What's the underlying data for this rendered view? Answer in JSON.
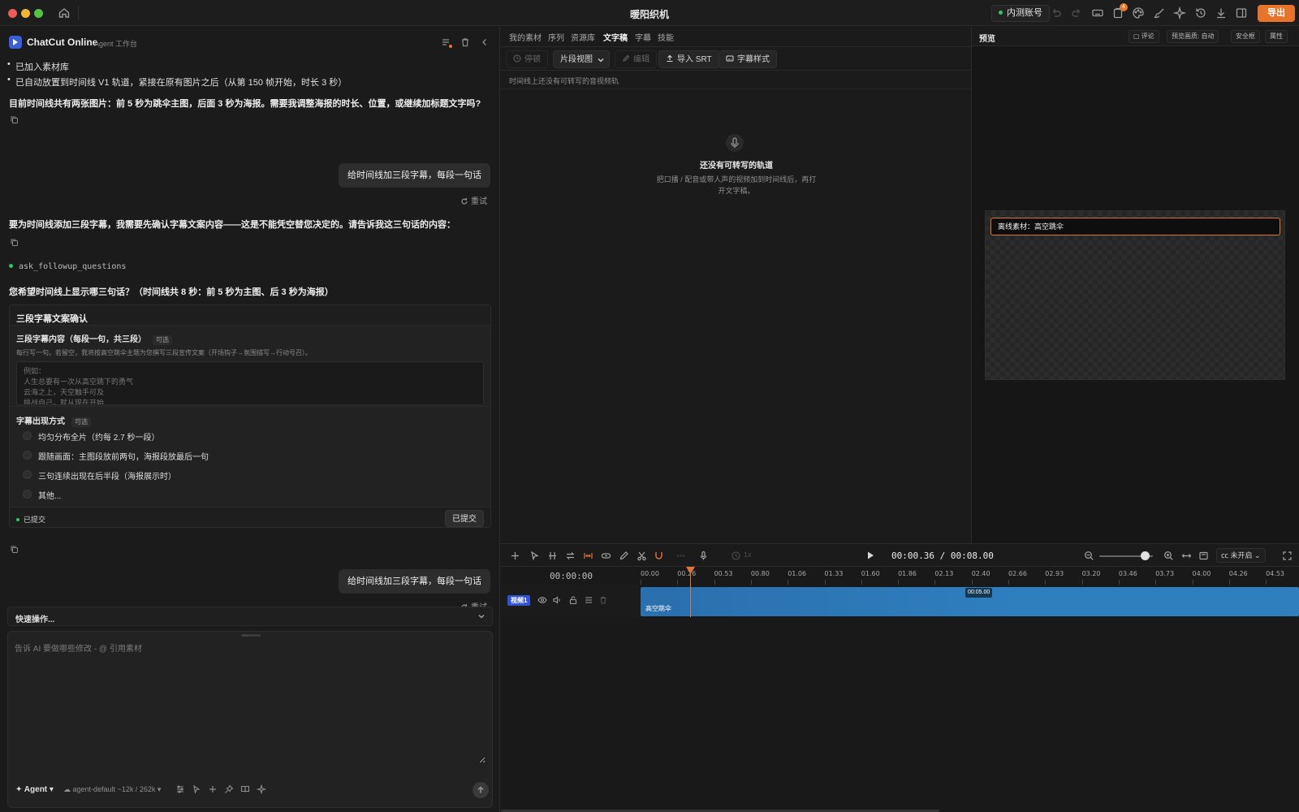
{
  "window": {
    "title": "暖阳织机",
    "beta_account": "内测账号",
    "export_label": "导出",
    "notification_count": "4",
    "colors": {
      "accent": "#e8742c",
      "clip": "#2f7fbf",
      "track_tag": "#3353d6"
    }
  },
  "agent_panel": {
    "app_name": "ChatCut Online",
    "subtitle": "Agent 工作台",
    "messages": {
      "bullet1": "已加入素材库",
      "bullet2": "已自动放置到时间线 V1 轨道，紧接在原有图片之后（从第 150 帧开始，时长 3 秒）",
      "assistant1": "目前时间线共有两张图片：前 5 秒为跳伞主图，后面 3 秒为海报。需要我调整海报的时长、位置，或继续加标题文字吗?",
      "user1": "给时间线加三段字幕，每段一句话",
      "retry1": "重试",
      "assistant2": "要为时间线添加三段字幕，我需要先确认字幕文案内容——这是不能凭空替您决定的。请告诉我这三句话的内容：",
      "tool_call": "ask_followup_questions",
      "assistant3": "您希望时间线上显示哪三句话？（时间线共 8 秒：前 5 秒为主图、后 3 秒为海报）",
      "user2": "给时间线加三段字幕，每段一句话",
      "retry2": "重试"
    },
    "form": {
      "title": "三段字幕文案确认",
      "q1_label": "三段字幕内容（每段一句，共三段）",
      "q1_optional": "可选",
      "q1_help": "每行写一句。若留空，我将按高空跳伞主题为您撰写三段宣传文案（开场钩子→氛围描写→行动号召）。",
      "q1_placeholder": "例如：\n人生总要有一次从高空跳下的勇气\n云海之上，天空触手可及\n挑战自己，就从现在开始",
      "q2_label": "字幕出现方式",
      "q2_optional": "可选",
      "options": [
        "均匀分布全片（约每 2.7 秒一段）",
        "跟随画面：主图段放前两句，海报段放最后一句",
        "三句连续出现在后半段（海报展示时）",
        "其他..."
      ],
      "status": "已提交",
      "submit_label": "已提交"
    },
    "quick_actions": "快速操作...",
    "composer": {
      "placeholder": "告诉 AI 要做哪些修改 - @ 引用素材",
      "mode": "Agent",
      "model": "agent-default ~12k / 262k"
    }
  },
  "transcript_panel": {
    "tabs": [
      "我的素材",
      "序列",
      "资源库",
      "文字稿",
      "字幕",
      "技能"
    ],
    "active_tab": "文字稿",
    "toolbar": {
      "pause": "停顿",
      "view_select": "片段视图",
      "edit": "编辑",
      "import_srt": "导入 SRT",
      "subtitle_style": "字幕样式"
    },
    "info": "时间线上还没有可转写的音视频轨",
    "empty_title": "还没有可转写的轨道",
    "empty_desc": "把口播 / 配音或带人声的视频加到时间线后，再打开文字稿。"
  },
  "preview_panel": {
    "title": "预览",
    "comment": "评论",
    "quality": "预览画质: 自动",
    "safe_frame": "安全框",
    "properties": "属性",
    "offline_banner": "离线素材：高空跳伞"
  },
  "timeline": {
    "speed": "1x",
    "timecode": "00:00.36 / 00:08.00",
    "zoom_level": 0.85,
    "cc_label": "未开启",
    "ruler_start": "00:00:00",
    "ticks": [
      "00.00",
      "00.26",
      "00.53",
      "00.80",
      "01.06",
      "01.33",
      "01.60",
      "01.86",
      "02.13",
      "02.40",
      "02.66",
      "02.93",
      "03.20",
      "03.46",
      "03.73",
      "04.00",
      "04.26",
      "04.53"
    ],
    "track_name": "视频1",
    "clip_name": "高空跳伞",
    "clip_duration": "00:05.00"
  }
}
